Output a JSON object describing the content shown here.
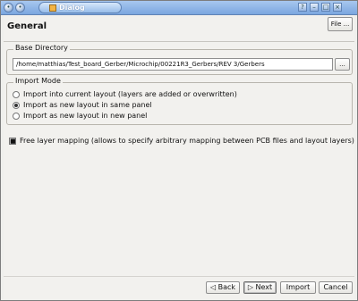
{
  "window": {
    "title": "Dialog",
    "controls": [
      "help-icon",
      "minimize-icon",
      "maximize-icon",
      "close-icon"
    ]
  },
  "header": {
    "title": "General",
    "file_button_label": "File ..."
  },
  "base_directory": {
    "group_title": "Base Directory",
    "path": "/home/matthias/Test_board_Gerber/Microchip/00221R3_Gerbers/REV 3/Gerbers",
    "browse_label": "..."
  },
  "import_mode": {
    "group_title": "Import Mode",
    "options": [
      {
        "label": "Import into current layout (layers are added or overwritten)",
        "selected": false
      },
      {
        "label": "Import as new layout in same panel",
        "selected": true
      },
      {
        "label": "Import as new layout in new panel",
        "selected": false
      }
    ]
  },
  "options": {
    "free_layer_mapping_label": "Free layer mapping (allows to specify arbitrary mapping between PCB files and layout layers)",
    "free_layer_mapping_checked": true
  },
  "footer": {
    "back_label": "Back",
    "next_label": "Next",
    "import_label": "Import",
    "cancel_label": "Cancel"
  }
}
